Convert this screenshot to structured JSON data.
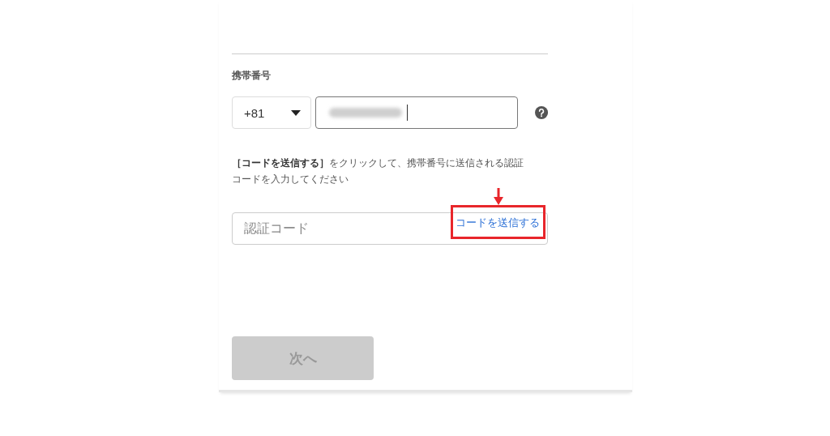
{
  "phone": {
    "label": "携帯番号",
    "country_code": "+81",
    "value_redacted": true
  },
  "instruction": "**［コードを送信する］**をクリックして、携帯番号に送信される認証コードを入力してください",
  "code_field": {
    "placeholder": "認証コード",
    "send_link": "コードを送信する",
    "highlighted": true
  },
  "next_button": {
    "label": "次へ",
    "disabled": true
  }
}
